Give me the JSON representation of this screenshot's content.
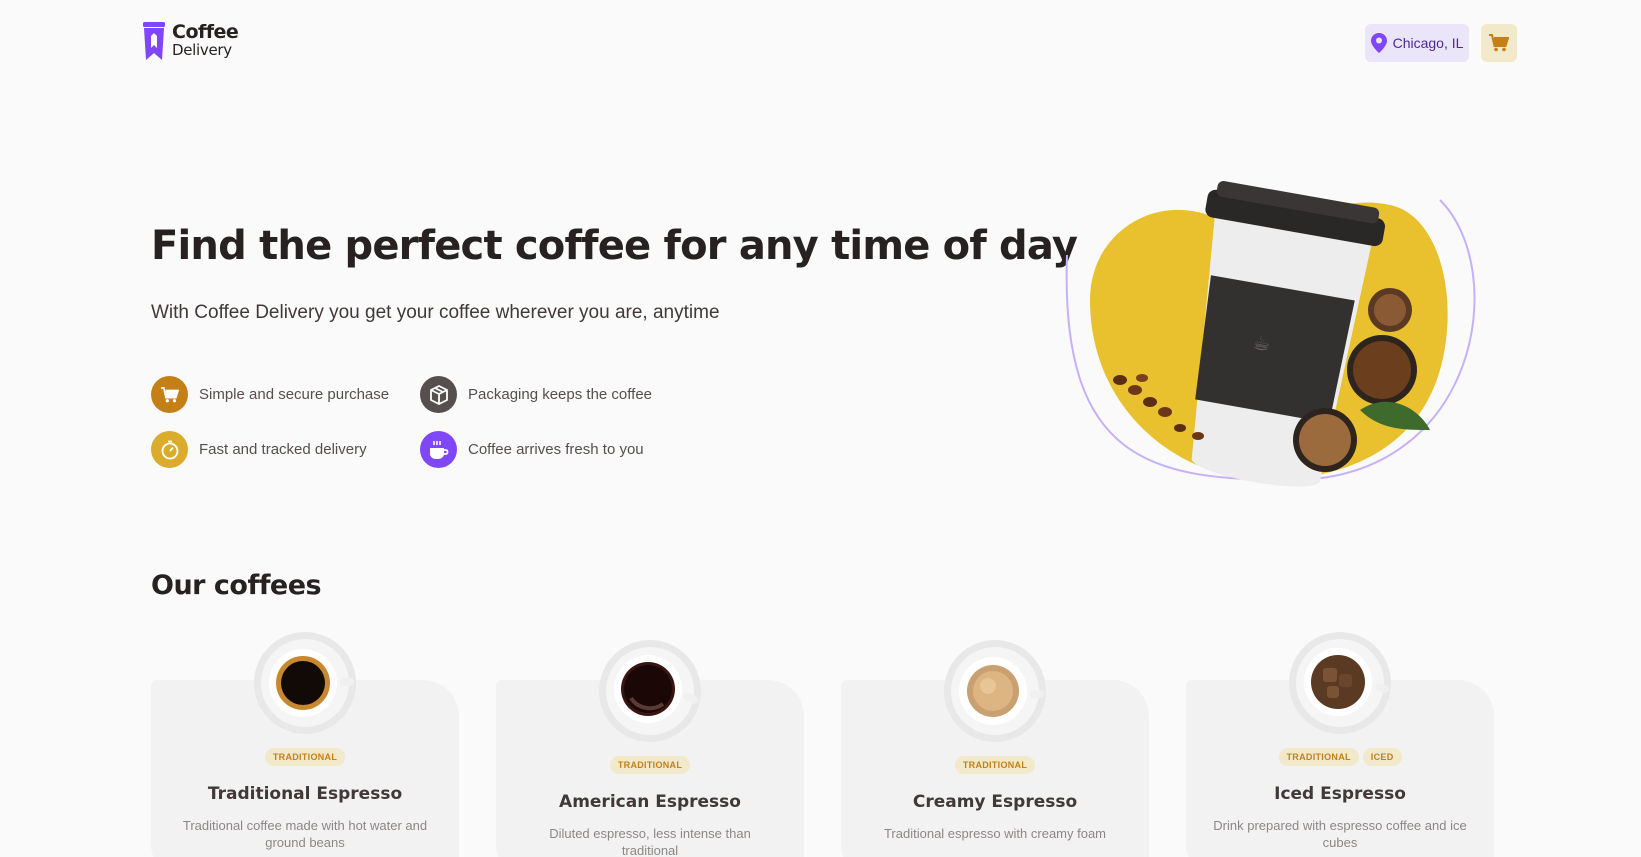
{
  "header": {
    "logo": {
      "line1": "Coffee",
      "line2": "Delivery"
    },
    "location": "Chicago, IL"
  },
  "hero": {
    "title": "Find the perfect coffee for any time of day",
    "subtitle": "With Coffee Delivery you get your coffee wherever you are, anytime",
    "features": [
      {
        "label": "Simple and secure purchase",
        "icon": "cart-icon",
        "color": "#C47F17"
      },
      {
        "label": "Packaging keeps the coffee",
        "icon": "package-icon",
        "color": "#574F4D"
      },
      {
        "label": "Fast and tracked delivery",
        "icon": "timer-icon",
        "color": "#DBAC2C"
      },
      {
        "label": "Coffee arrives fresh to you",
        "icon": "coffee-icon",
        "color": "#8047F8"
      }
    ]
  },
  "section": {
    "title": "Our coffees"
  },
  "coffees": [
    {
      "name": "Traditional Espresso",
      "tags": [
        "TRADITIONAL"
      ],
      "description": "Traditional coffee made with hot water and ground beans"
    },
    {
      "name": "American Espresso",
      "tags": [
        "TRADITIONAL"
      ],
      "description": "Diluted espresso, less intense than traditional"
    },
    {
      "name": "Creamy Espresso",
      "tags": [
        "TRADITIONAL"
      ],
      "description": "Traditional espresso with creamy foam"
    },
    {
      "name": "Iced Espresso",
      "tags": [
        "TRADITIONAL",
        "ICED"
      ],
      "description": "Drink prepared with espresso coffee and ice cubes"
    }
  ],
  "colors": {
    "yellow": "#DBAC2C",
    "yellow_dark": "#C47F17",
    "yellow_light": "#F1E9C9",
    "purple": "#8047F8",
    "purple_dark": "#4B2995",
    "purple_light": "#EBE5F9"
  }
}
